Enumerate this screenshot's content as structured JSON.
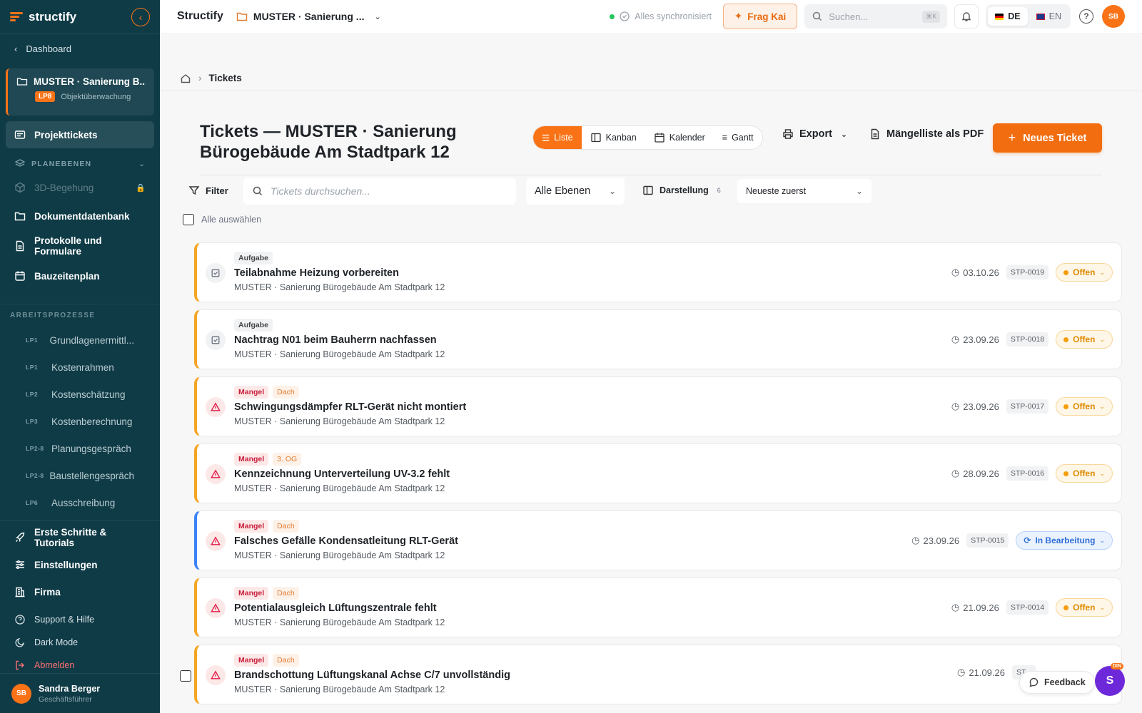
{
  "sidebar": {
    "brand": "structify",
    "dashboard_label": "Dashboard",
    "project": {
      "name": "MUSTER · Sanierung B...",
      "phase_badge": "LP8",
      "phase_label": "Objektüberwachung"
    },
    "nav_primary": [
      {
        "label": "Projekttickets",
        "icon": "ticket-icon",
        "active": true
      }
    ],
    "planebenen_label": "PLANEBENEN",
    "begehung_label": "3D-Begehung",
    "nav_secondary": [
      {
        "label": "Dokumentdatenbank",
        "icon": "folder-icon"
      },
      {
        "label": "Protokolle und Formulare",
        "icon": "document-icon"
      },
      {
        "label": "Bauzeitenplan",
        "icon": "calendar-icon"
      }
    ],
    "processes_label": "ARBEITSPROZESSE",
    "processes": [
      {
        "tag": "LP1",
        "label": "Grundlagenermittl..."
      },
      {
        "tag": "LP1",
        "label": "Kostenrahmen"
      },
      {
        "tag": "LP2",
        "label": "Kostenschätzung"
      },
      {
        "tag": "LP3",
        "label": "Kostenberechnung"
      },
      {
        "tag": "LP2-8",
        "label": "Planungsgespräch"
      },
      {
        "tag": "LP2-8",
        "label": "Baustellengespräch"
      },
      {
        "tag": "LP6",
        "label": "Ausschreibung"
      }
    ],
    "bottom_nav": [
      {
        "label": "Erste Schritte & Tutorials",
        "icon": "rocket-icon"
      },
      {
        "label": "Einstellungen",
        "icon": "sliders-icon"
      },
      {
        "label": "Firma",
        "icon": "building-icon"
      }
    ],
    "support_label": "Support & Hilfe",
    "darkmode_label": "Dark Mode",
    "logout_label": "Abmelden",
    "user": {
      "initials": "SB",
      "name": "Sandra Berger",
      "role": "Geschäftsführer"
    }
  },
  "topbar": {
    "brand": "Structify",
    "project_selector": "MUSTER · Sanierung ...",
    "sync_status": "Alles synchronisiert",
    "ask_label": "Frag Kai",
    "search_placeholder": "Suchen...",
    "search_shortcut": "⌘K",
    "lang_de": "DE",
    "lang_en": "EN",
    "user_initials": "SB"
  },
  "breadcrumb": {
    "current": "Tickets"
  },
  "header": {
    "title": "Tickets — MUSTER · Sanierung Bürogebäude Am Stadtpark 12",
    "views": [
      "Liste",
      "Kanban",
      "Kalender",
      "Gantt"
    ],
    "active_view": "Liste",
    "export_label": "Export",
    "pdf_label": "Mängelliste als PDF",
    "new_ticket_label": "Neues Ticket"
  },
  "filters": {
    "filter_label": "Filter",
    "search_placeholder": "Tickets durchsuchen...",
    "levels_value": "Alle Ebenen",
    "display_label": "Darstellung",
    "display_count": "6",
    "sort_value": "Neueste zuerst",
    "select_all_label": "Alle auswählen"
  },
  "tickets": [
    {
      "type": "Aufgabe",
      "location": "",
      "title": "Teilabnahme Heizung vorbereiten",
      "project": "MUSTER · Sanierung Bürogebäude Am Stadtpark 12",
      "date": "03.10.26",
      "id": "STP-0019",
      "status": "Offen"
    },
    {
      "type": "Aufgabe",
      "location": "",
      "title": "Nachtrag N01 beim Bauherrn nachfassen",
      "project": "MUSTER · Sanierung Bürogebäude Am Stadtpark 12",
      "date": "23.09.26",
      "id": "STP-0018",
      "status": "Offen"
    },
    {
      "type": "Mangel",
      "location": "Dach",
      "title": "Schwingungsdämpfer RLT-Gerät nicht montiert",
      "project": "MUSTER · Sanierung Bürogebäude Am Stadtpark 12",
      "date": "23.09.26",
      "id": "STP-0017",
      "status": "Offen"
    },
    {
      "type": "Mangel",
      "location": "3. OG",
      "title": "Kennzeichnung Unterverteilung UV-3.2 fehlt",
      "project": "MUSTER · Sanierung Bürogebäude Am Stadtpark 12",
      "date": "28.09.26",
      "id": "STP-0016",
      "status": "Offen"
    },
    {
      "type": "Mangel",
      "location": "Dach",
      "title": "Falsches Gefälle Kondensatleitung RLT-Gerät",
      "project": "MUSTER · Sanierung Bürogebäude Am Stadtpark 12",
      "date": "23.09.26",
      "id": "STP-0015",
      "status": "In Bearbeitung"
    },
    {
      "type": "Mangel",
      "location": "Dach",
      "title": "Potentialausgleich Lüftungszentrale fehlt",
      "project": "MUSTER · Sanierung Bürogebäude Am Stadtpark 12",
      "date": "21.09.26",
      "id": "STP-0014",
      "status": "Offen"
    },
    {
      "type": "Mangel",
      "location": "Dach",
      "title": "Brandschottung Lüftungskanal Achse C/7 unvollständig",
      "project": "MUSTER · Sanierung Bürogebäude Am Stadtpark 12",
      "date": "21.09.26",
      "id": "ST...",
      "status": ""
    }
  ],
  "floating": {
    "feedback_label": "Feedback",
    "chatbot_letter": "S",
    "chatbot_badge": "DIN"
  },
  "colors": {
    "sidebar_bg": "#0f3b47",
    "accent": "#f26d0f",
    "open_status": "#e08a00",
    "progress_status": "#2f6fd8"
  }
}
